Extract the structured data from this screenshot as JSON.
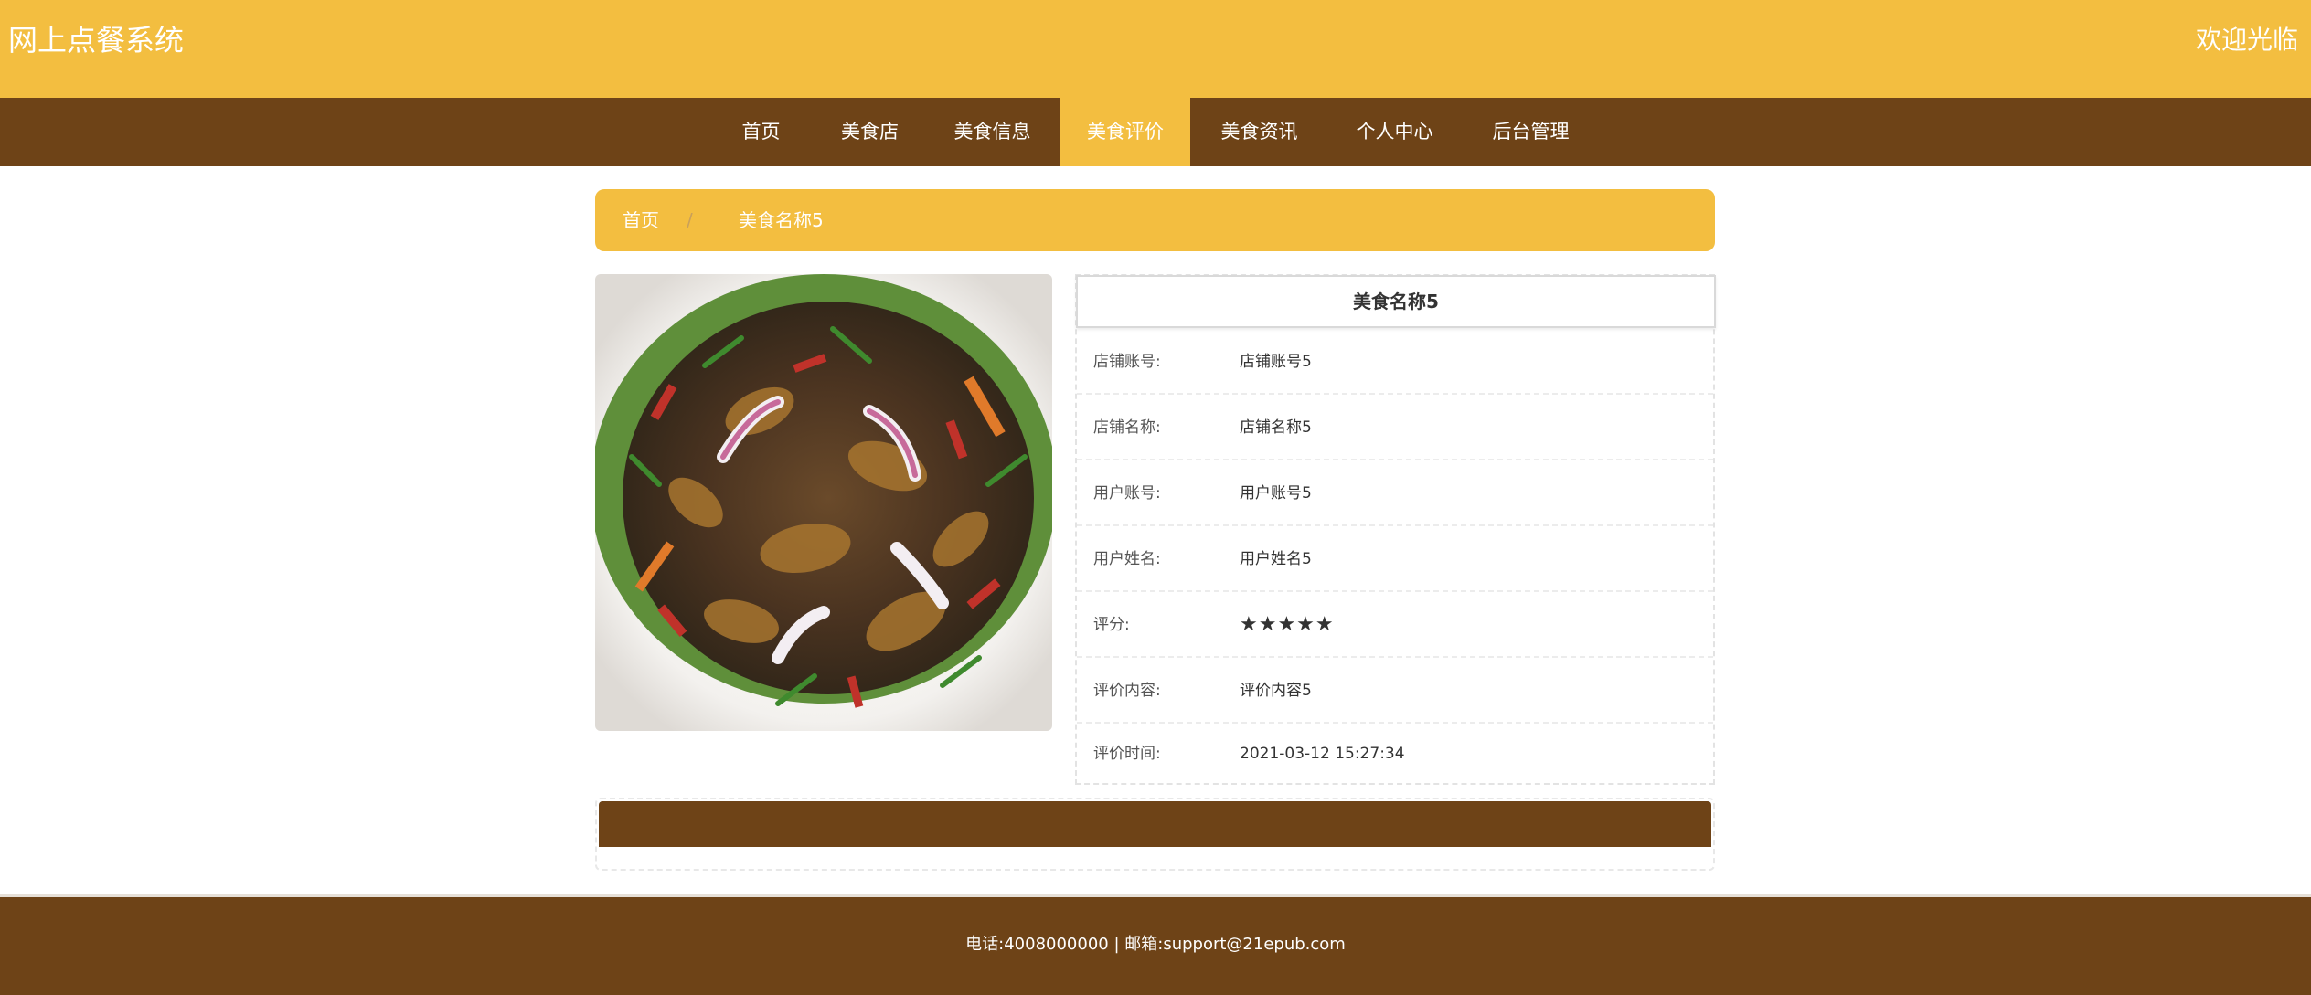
{
  "header": {
    "logo": "网上点餐系统",
    "welcome": "欢迎光临"
  },
  "nav": {
    "items": [
      {
        "label": "首页"
      },
      {
        "label": "美食店"
      },
      {
        "label": "美食信息"
      },
      {
        "label": "美食评价",
        "active": true
      },
      {
        "label": "美食资讯"
      },
      {
        "label": "个人中心"
      },
      {
        "label": "后台管理"
      }
    ]
  },
  "breadcrumb": {
    "home": "首页",
    "separator": "/",
    "current": "美食名称5"
  },
  "detail": {
    "title": "美食名称5",
    "rows": [
      {
        "label": "店铺账号:",
        "value": "店铺账号5"
      },
      {
        "label": "店铺名称:",
        "value": "店铺名称5"
      },
      {
        "label": "用户账号:",
        "value": "用户账号5"
      },
      {
        "label": "用户姓名:",
        "value": "用户姓名5"
      },
      {
        "label": "评分:",
        "value": "★★★★★",
        "rating": 5,
        "max": 5
      },
      {
        "label": "评价内容:",
        "value": "评价内容5"
      },
      {
        "label": "评价时间:",
        "value": "2021-03-12 15:27:34"
      }
    ]
  },
  "footer": {
    "contact": "电话:4008000000 | 邮箱:support@21epub.com"
  },
  "colors": {
    "primary": "#f3be40",
    "secondary": "#6e4317"
  }
}
